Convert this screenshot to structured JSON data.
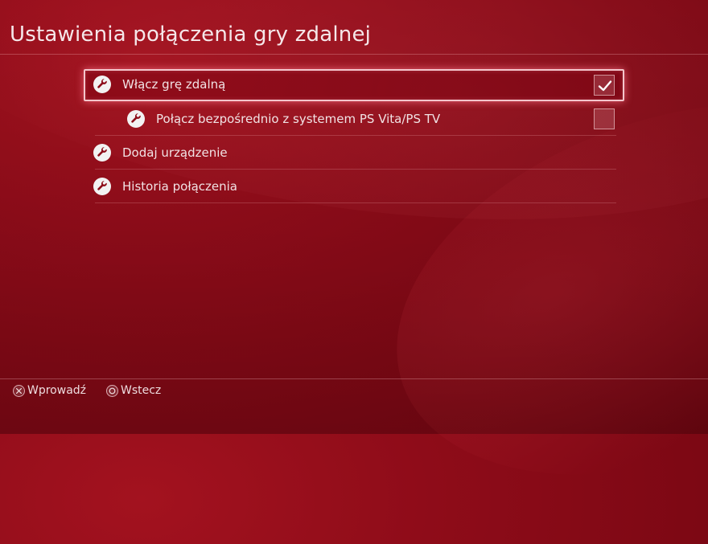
{
  "page": {
    "title": "Ustawienia połączenia gry zdalnej"
  },
  "menu": {
    "items": [
      {
        "label": "Włącz grę zdalną",
        "icon": "wrench-icon",
        "checked": true,
        "focused": true
      },
      {
        "label": "Połącz bezpośrednio z systemem PS Vita/PS TV",
        "icon": "wrench-icon",
        "checked": false,
        "focused": false
      },
      {
        "label": "Dodaj urządzenie",
        "icon": "wrench-icon"
      },
      {
        "label": "Historia połączenia",
        "icon": "wrench-icon"
      }
    ]
  },
  "footer": {
    "enter_label": "Wprowadź",
    "enter_icon": "cross-button-icon",
    "back_label": "Wstecz",
    "back_icon": "circle-button-icon"
  },
  "colors": {
    "background": "#8f0c19",
    "focus_glow": "#f4c6cc",
    "text": "#f3e4e6"
  }
}
